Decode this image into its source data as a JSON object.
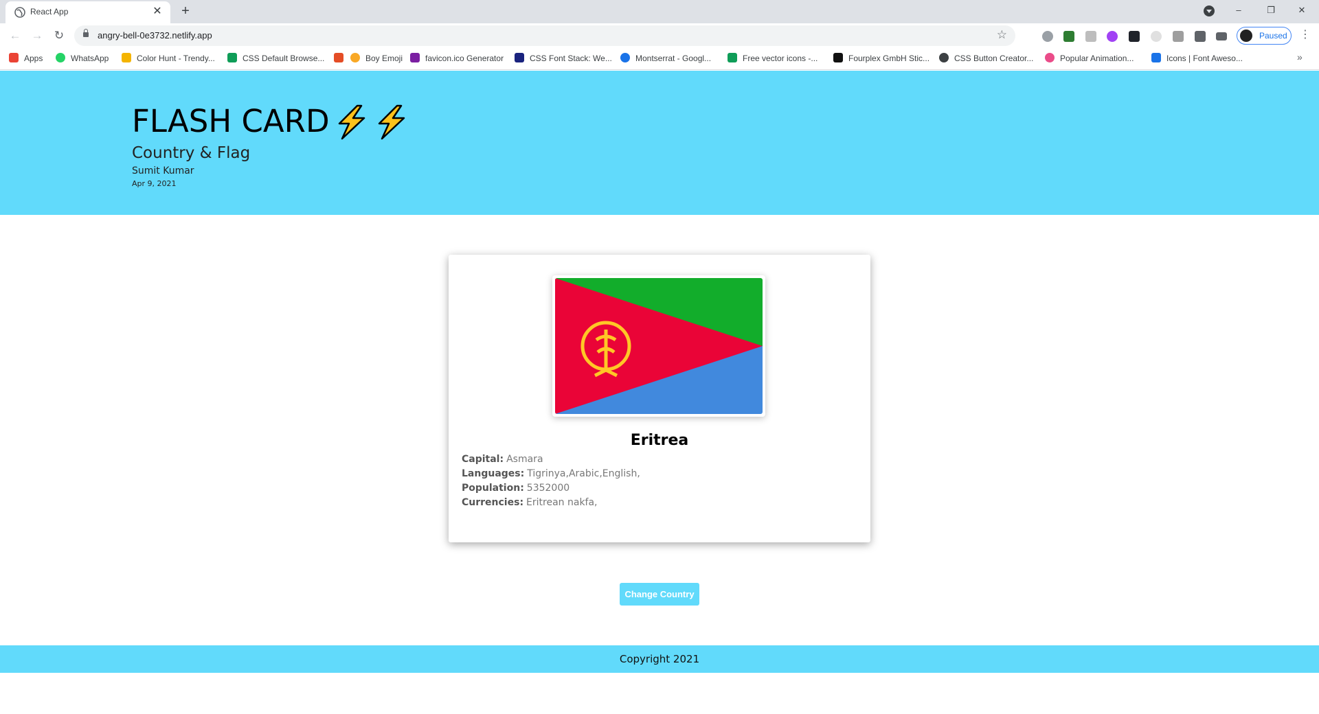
{
  "browser": {
    "tab_title": "React App",
    "tab_close": "✕",
    "new_tab": "+",
    "url": "angry-bell-0e3732.netlify.app",
    "profile_status": "Paused",
    "window_controls": {
      "minimize": "–",
      "restore": "❐",
      "close": "✕"
    }
  },
  "bookmarks": [
    {
      "label": "Apps",
      "icon": "apps-grid-icon",
      "color": "#ea4335"
    },
    {
      "label": "WhatsApp",
      "icon": "whatsapp-icon",
      "color": "#25d366"
    },
    {
      "label": "Color Hunt - Trendy...",
      "icon": "color-hunt-icon",
      "color": "#f4b400"
    },
    {
      "label": "CSS Default Browse...",
      "icon": "w3-icon",
      "color": "#0f9d58"
    },
    {
      "label": "",
      "icon": "html5-icon",
      "color": "#e44d26"
    },
    {
      "label": "Boy Emoji",
      "icon": "emoji-icon",
      "color": "#f9a825"
    },
    {
      "label": "favicon.ico Generator",
      "icon": "favicon-icon",
      "color": "#7b1fa2"
    },
    {
      "label": "CSS Font Stack: We...",
      "icon": "cssfont-icon",
      "color": "#1a237e"
    },
    {
      "label": "Montserrat - Googl...",
      "icon": "google-fonts-icon",
      "color": "#1a73e8"
    },
    {
      "label": "Free vector icons -...",
      "icon": "vector-icon",
      "color": "#0f9d58"
    },
    {
      "label": "Fourplex GmbH Stic...",
      "icon": "fourplex-icon",
      "color": "#111111"
    },
    {
      "label": "CSS Button Creator...",
      "icon": "gear-icon",
      "color": "#3c4043"
    },
    {
      "label": "Popular Animation...",
      "icon": "dribbble-icon",
      "color": "#ea4c89"
    },
    {
      "label": "Icons | Font Aweso...",
      "icon": "flag-icon",
      "color": "#1a73e8"
    }
  ],
  "header": {
    "title": "FLASH CARD",
    "subtitle": "Country & Flag",
    "author": "Sumit Kumar",
    "date": "Apr 9, 2021"
  },
  "card": {
    "country": "Eritrea",
    "flag_colors": {
      "green": "#12ad2b",
      "red": "#ea0437",
      "blue": "#4189dd",
      "emblem": "#ffc726"
    },
    "capital_label": "Capital:",
    "capital": "Asmara",
    "languages_label": "Languages:",
    "languages": "Tigrinya,Arabic,English,",
    "population_label": "Population:",
    "population": "5352000",
    "currencies_label": "Currencies:",
    "currencies": "Eritrean nakfa,"
  },
  "actions": {
    "change_country": "Change Country"
  },
  "footer": {
    "copyright": "Copyright 2021"
  },
  "theme": {
    "accent": "#61dafb"
  }
}
